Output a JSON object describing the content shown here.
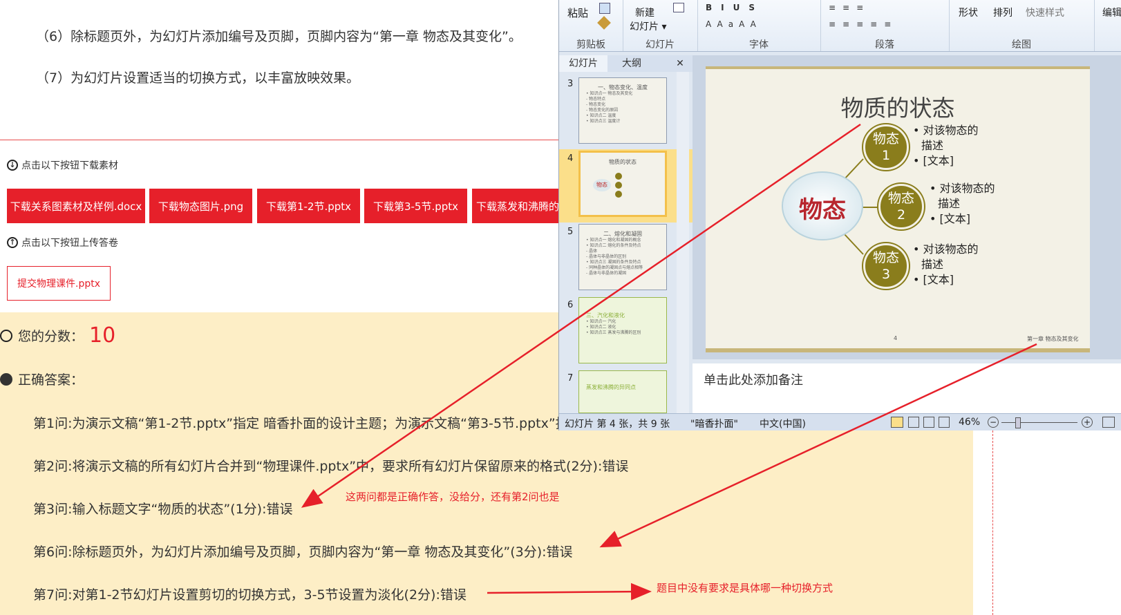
{
  "questions": {
    "q6": "（6）除标题页外，为幻灯片添加编号及页脚，页脚内容为“第一章 物态及其变化”。",
    "q7": "（7）为幻灯片设置适当的切换方式，以丰富放映效果。"
  },
  "download": {
    "hint": "点击以下按钮下载素材",
    "buttons": [
      "下载关系图素材及样例.docx",
      "下载物态图片.png",
      "下载第1-2节.pptx",
      "下载第3-5节.pptx",
      "下载蒸发和沸腾的"
    ]
  },
  "upload": {
    "hint": "点击以下按钮上传答卷",
    "button": "提交物理课件.pptx"
  },
  "score": {
    "label": "您的分数：",
    "value": "10"
  },
  "answers": {
    "title": "正确答案：",
    "lines": [
      "第1问:为演示文稿“第1-2节.pptx”指定 暗香扑面的设计主题；为演示文稿“第3-5节.pptx”指",
      "第2问:将演示文稿的所有幻灯片合并到“物理课件.pptx”中，要求所有幻灯片保留原来的格式(2分):错误",
      "第3问:输入标题文字“物质的状态”(1分):错误",
      "第6问:除标题页外，为幻灯片添加编号及页脚，页脚内容为“第一章 物态及其变化”(3分):错误",
      "第7问:对第1-2节幻灯片设置剪切的切换方式，3-5节设置为淡化(2分):错误"
    ]
  },
  "annotations": {
    "note1": "这两问都是正确作答，没给分，还有第2问也是",
    "note2": "题目中没有要求是具体哪一种切换方式"
  },
  "ribbon": {
    "paste": "粘贴",
    "new_slide_1": "新建",
    "new_slide_2": "幻灯片 ▾",
    "shape": "形状",
    "arrange": "排列",
    "quick_style": "快速样式",
    "edit": "编辑",
    "groups": [
      "剪贴板",
      "幻灯片",
      "字体",
      "段落",
      "绘图"
    ]
  },
  "panel": {
    "tab_slides": "幻灯片",
    "tab_outline": "大纲",
    "close": "✕"
  },
  "thumbnails": [
    {
      "num": "3",
      "title": "一、物态变化、温度",
      "lines": [
        "• 知识点一  物态及其变化",
        "  - 物态特点",
        "  - 物态变化",
        "  - 物态变化的原因",
        "• 知识点二  温度",
        "• 知识点三  温度计"
      ]
    },
    {
      "num": "4",
      "title": "物质的状态",
      "lines": []
    },
    {
      "num": "5",
      "title": "二、熔化和凝固",
      "lines": [
        "• 知识点一  熔化和凝固的概念",
        "• 知识点二  熔化的条件及特点",
        "  - 晶体",
        "  - 晶体与非晶体的区别",
        "• 知识点三  凝固的条件及特点",
        "  - 同种晶体的凝固点与熔点相等",
        "  - 晶体与非晶体的凝固"
      ]
    },
    {
      "num": "6",
      "title": "三、汽化和液化",
      "lines": [
        "• 知识点一  汽化",
        "• 知识点二  液化",
        "• 知识点三  蒸发与沸腾的区别"
      ]
    },
    {
      "num": "7",
      "title": "蒸发和沸腾的异同点",
      "lines": []
    }
  ],
  "slide": {
    "title": "物质的状态",
    "center": "物态",
    "circles": [
      {
        "line1": "物态",
        "line2": "1"
      },
      {
        "line1": "物态",
        "line2": "2"
      },
      {
        "line1": "物态",
        "line2": "3"
      }
    ],
    "bullet_a": "• 对该物态的",
    "bullet_b": "描述",
    "bullet_c": "• [文本]",
    "page_num": "4",
    "footer": "第一章 物态及其变化"
  },
  "notes_placeholder": "单击此处添加备注",
  "status": {
    "slide_info": "幻灯片 第 4 张，共 9 张",
    "theme": "\"暗香扑面\"",
    "language": "中文(中国)",
    "zoom": "46%"
  },
  "colors": {
    "accent_red": "#e6202a",
    "answer_bg": "#fdeec6",
    "circle": "#8a7d1c",
    "selection": "#fbdf8a"
  }
}
